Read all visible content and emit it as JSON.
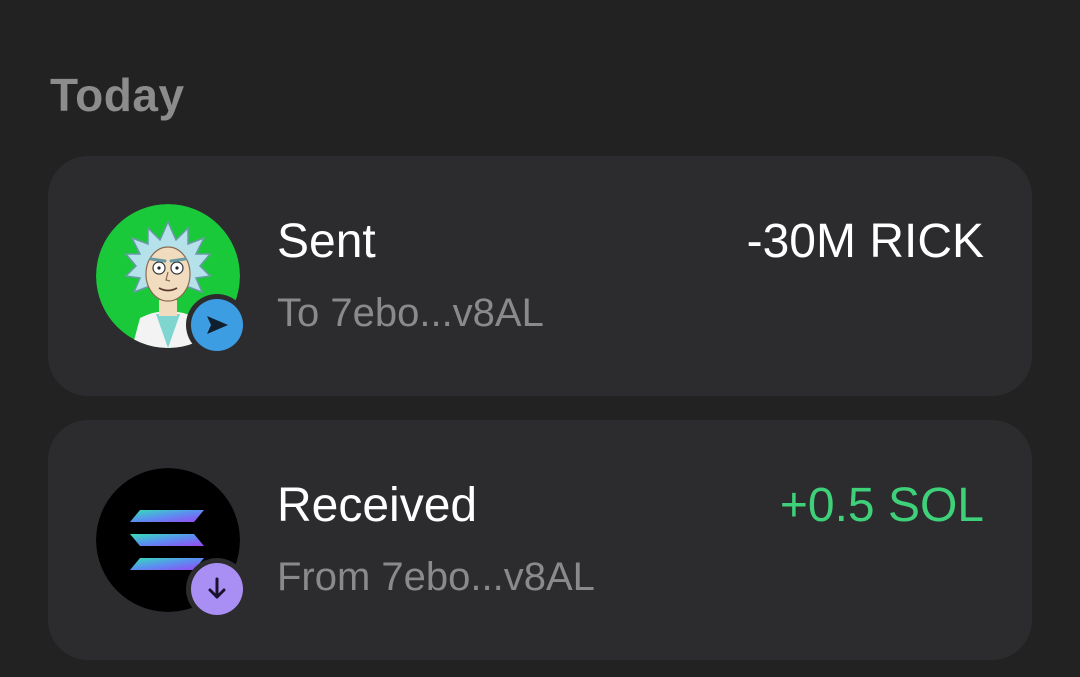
{
  "section": {
    "title": "Today"
  },
  "transactions": [
    {
      "type_label": "Sent",
      "counterparty": "To 7ebo...v8AL",
      "amount": "-30M RICK",
      "amount_color": "#ffffff",
      "avatar_icon": "rick-token-icon",
      "avatar_bg": "#19c93a",
      "badge_icon": "send-arrow-icon",
      "badge_color": "#3d9de3"
    },
    {
      "type_label": "Received",
      "counterparty": "From 7ebo...v8AL",
      "amount": "+0.5 SOL",
      "amount_color": "#3ed17a",
      "avatar_icon": "solana-token-icon",
      "avatar_bg": "#000000",
      "badge_icon": "arrow-down-icon",
      "badge_color": "#a98ef3"
    }
  ]
}
